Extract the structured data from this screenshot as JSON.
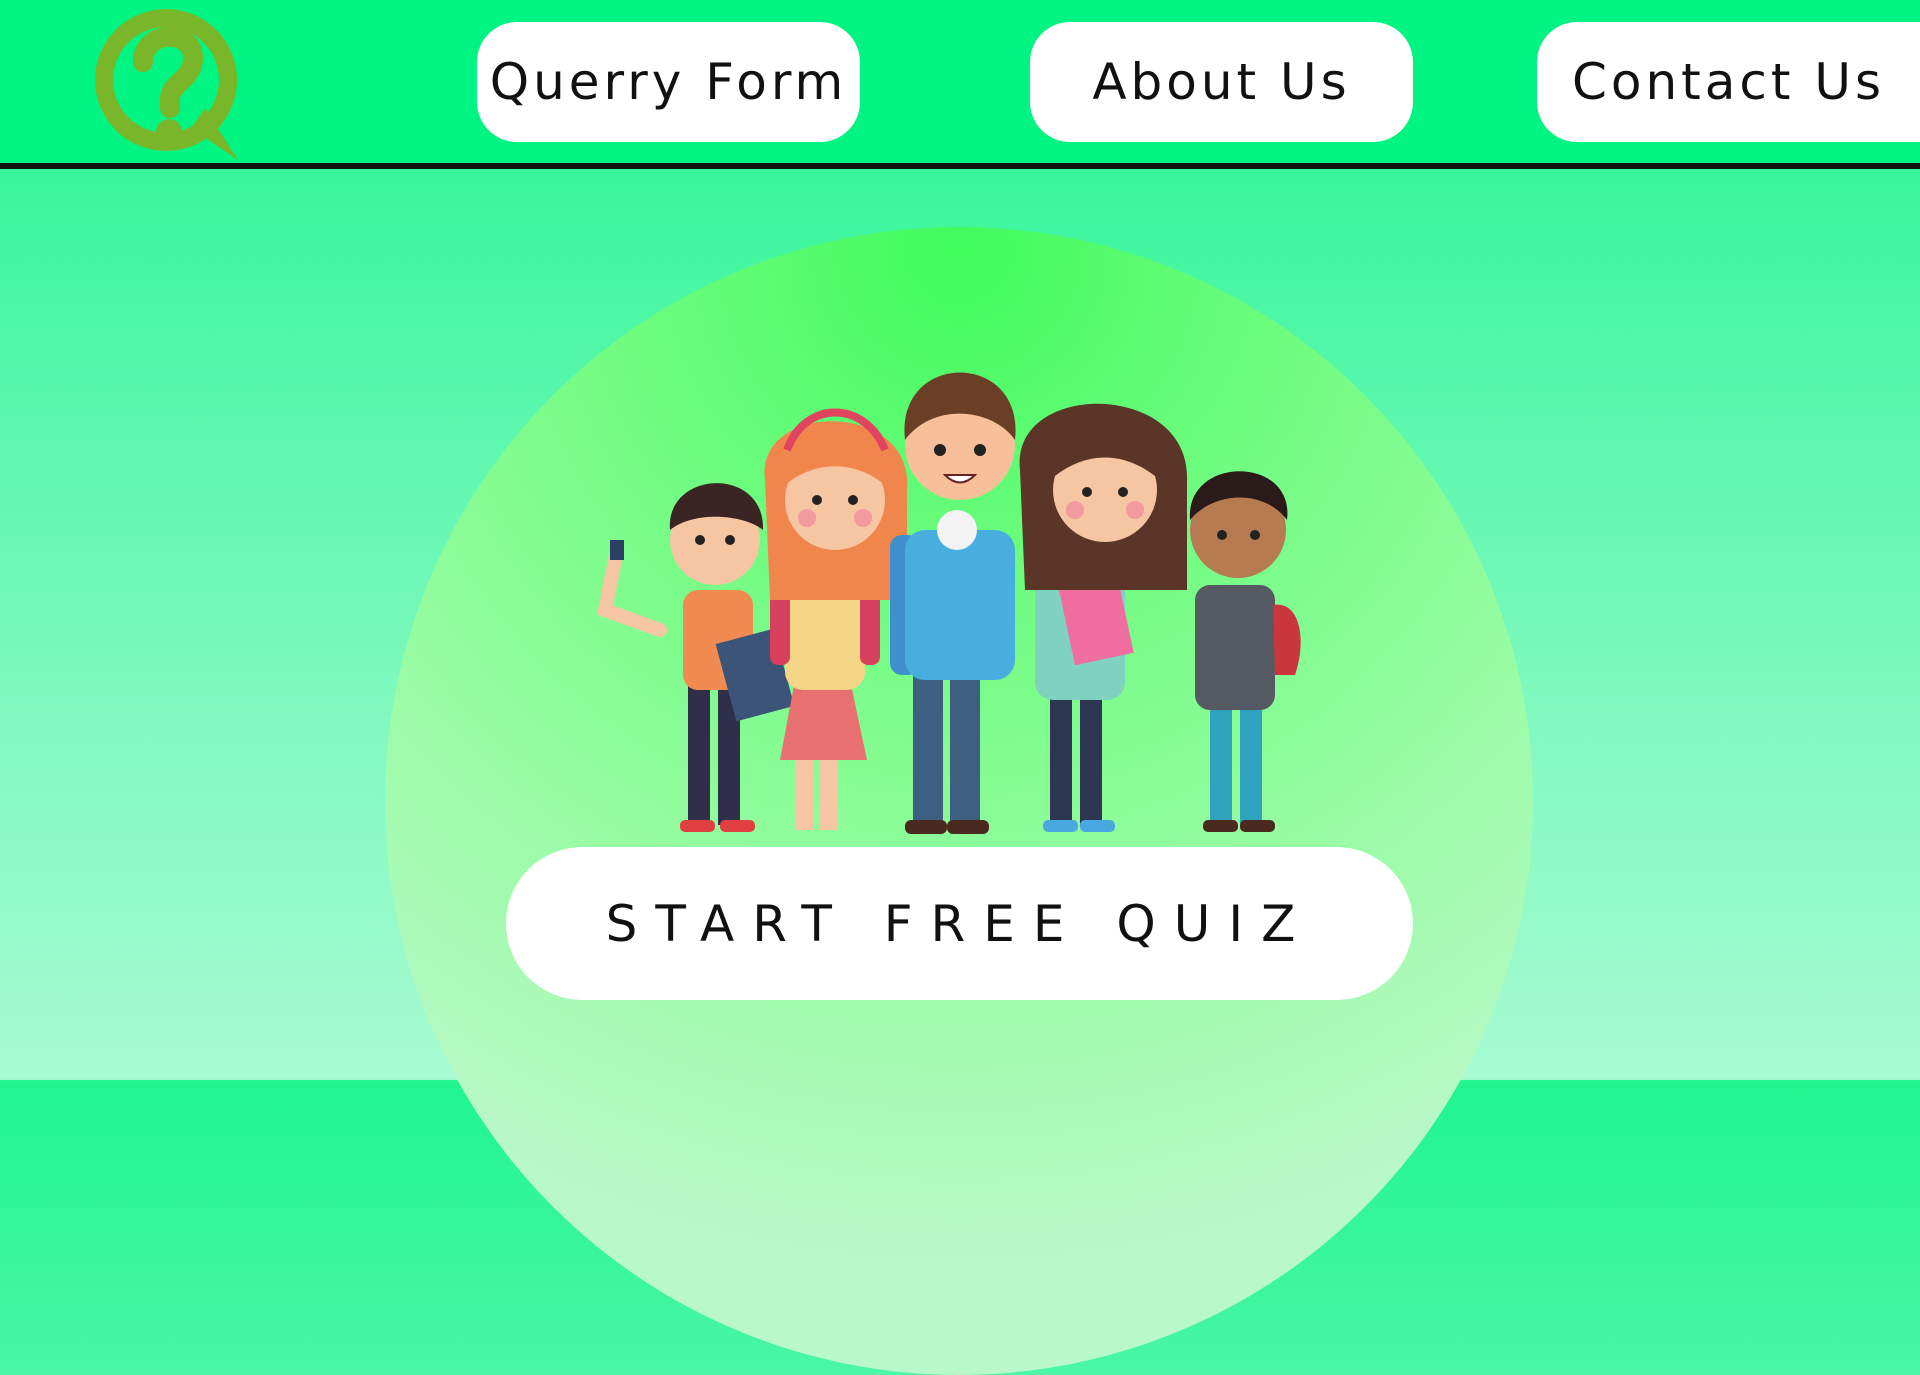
{
  "header": {
    "logo_icon": "question-bubble-icon",
    "nav": [
      {
        "label": "Querry Form"
      },
      {
        "label": "About Us"
      },
      {
        "label": "Contact Us"
      }
    ]
  },
  "hero": {
    "illustration": "students-group-illustration",
    "cta_label": "START FREE QUIZ"
  },
  "colors": {
    "header_bg": "#00f482",
    "accent_green": "#3ffb5c",
    "logo_green": "#7ab62a",
    "button_bg": "#ffffff"
  }
}
